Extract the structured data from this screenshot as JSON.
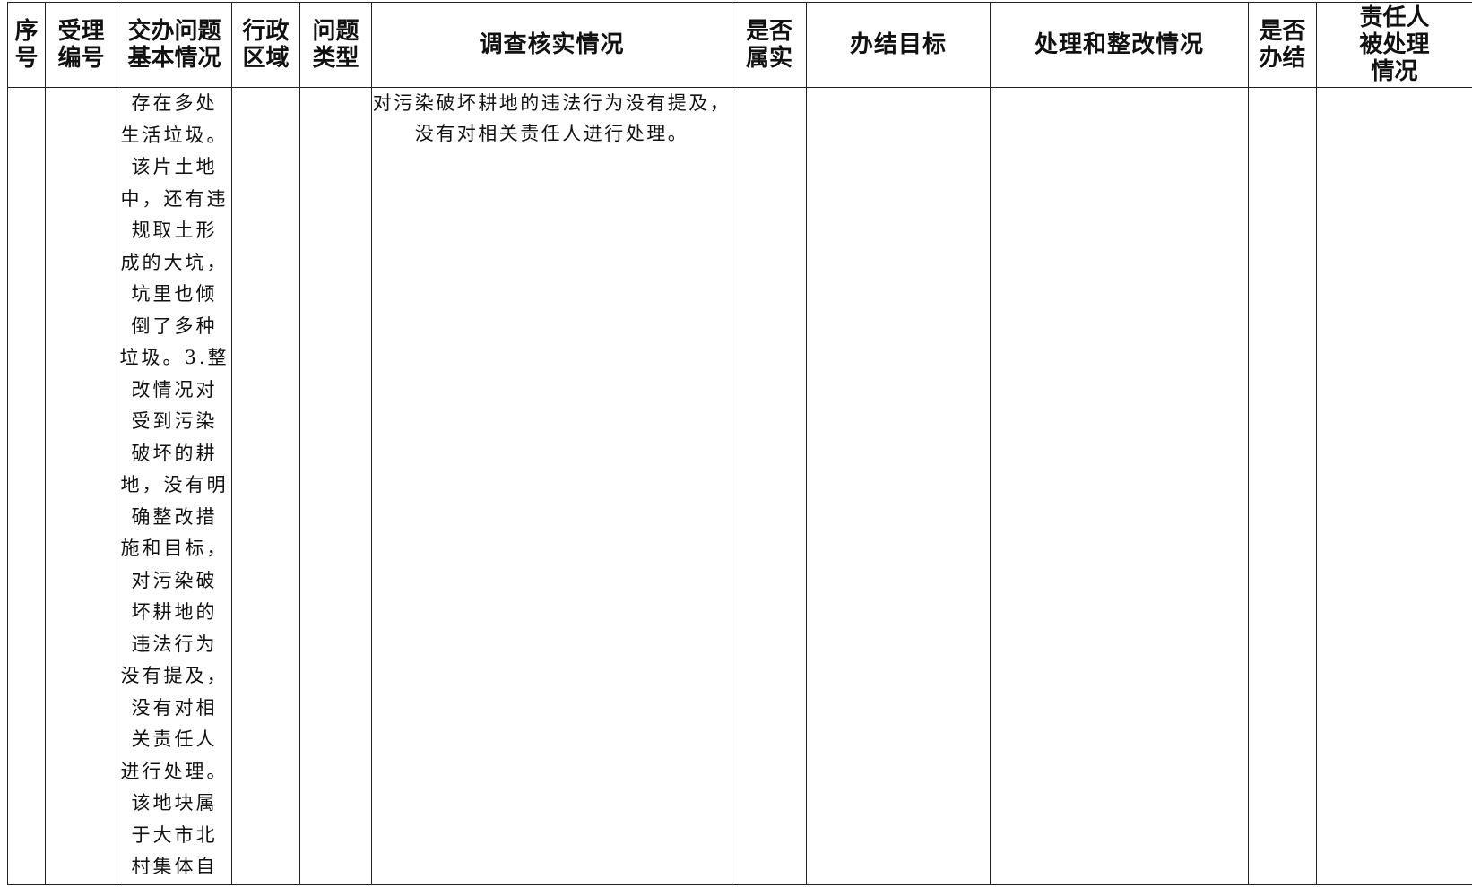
{
  "table": {
    "headers": {
      "seq": [
        "序",
        "号"
      ],
      "accept_no": [
        "受理",
        "编号"
      ],
      "basic": [
        "交办问题",
        "基本情况"
      ],
      "region": [
        "行政",
        "区域"
      ],
      "type": [
        "问题",
        "类型"
      ],
      "survey": [
        "调查核实情况"
      ],
      "is_true": [
        "是否",
        "属实"
      ],
      "goal": [
        "办结目标"
      ],
      "rectify": [
        "处理和整改情况"
      ],
      "closed": [
        "是否",
        "办结"
      ],
      "punish": [
        "责任人",
        "被处理",
        "情况"
      ]
    },
    "row": {
      "seq": "",
      "accept_no": "",
      "basic_lines": [
        "存在多处",
        "生活垃圾。",
        "该片土地",
        "中，还有违",
        "规取土形",
        "成的大坑，",
        "坑里也倾",
        "倒了多种",
        "垃圾。3.整",
        "改情况对",
        "受到污染",
        "破坏的耕",
        "地，没有明",
        "确整改措",
        "施和目标，",
        "对污染破",
        "坏耕地的",
        "违法行为",
        "没有提及，",
        "没有对相",
        "关责任人",
        "进行处理。",
        "该地块属",
        "于大市北",
        "村集体自"
      ],
      "region": "",
      "type": "",
      "survey_lines": [
        "对污染破坏耕地的违法行为没有提及，",
        "没有对相关责任人进行处理。"
      ],
      "is_true": "",
      "goal": "",
      "rectify": "",
      "closed": "",
      "punish": ""
    }
  }
}
